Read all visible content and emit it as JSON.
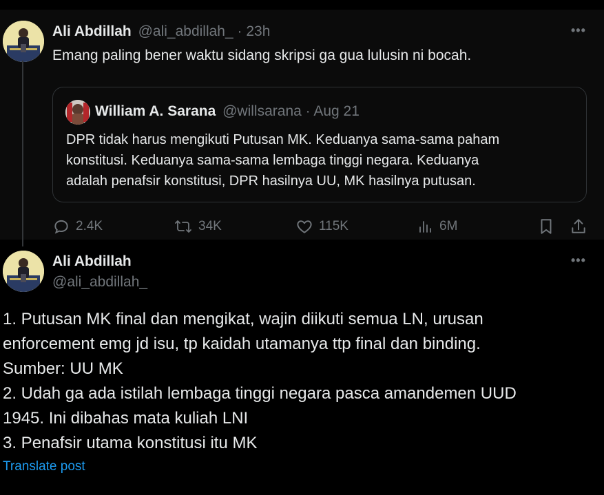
{
  "parent_tweet": {
    "author_name": "Ali Abdillah",
    "handle": "@ali_abdillah_",
    "separator": "·",
    "time": "23h",
    "text": "Emang paling bener waktu sidang skripsi ga gua lulusin ni bocah.",
    "quoted": {
      "author_name": "William A. Sarana",
      "handle": "@willsarana",
      "separator": "·",
      "date": "Aug 21",
      "lines": [
        "DPR tidak harus mengikuti Putusan MK. Keduanya sama-sama paham",
        "konstitusi. Keduanya sama-sama lembaga tinggi negara. Keduanya",
        "adalah penafsir konstitusi, DPR hasilnya UU, MK hasilnya putusan."
      ]
    },
    "actions": {
      "replies": "2.4K",
      "reposts": "34K",
      "likes": "115K",
      "views": "6M"
    }
  },
  "reply_tweet": {
    "author_name": "Ali Abdillah",
    "handle": "@ali_abdillah_",
    "lines": [
      "1. Putusan MK final dan mengikat, wajin diikuti semua LN, urusan",
      "enforcement emg jd isu, tp kaidah utamanya ttp final dan binding.",
      "Sumber: UU MK",
      "2. Udah ga ada istilah lembaga tinggi negara pasca amandemen UUD",
      "1945. Ini dibahas mata kuliah LNI",
      "3. Penafsir utama konstitusi itu MK"
    ],
    "translate_label": "Translate post"
  },
  "icons": {
    "more": "more-icon",
    "reply": "reply-icon",
    "repost": "repost-icon",
    "like": "heart-icon",
    "views": "views-icon",
    "bookmark": "bookmark-icon",
    "share": "share-icon"
  },
  "colors": {
    "background": "#000000",
    "parent_background": "#0b0b0b",
    "text": "#e7e9ea",
    "muted": "#71767b",
    "border": "#2f3336",
    "link": "#1d9bf0"
  }
}
